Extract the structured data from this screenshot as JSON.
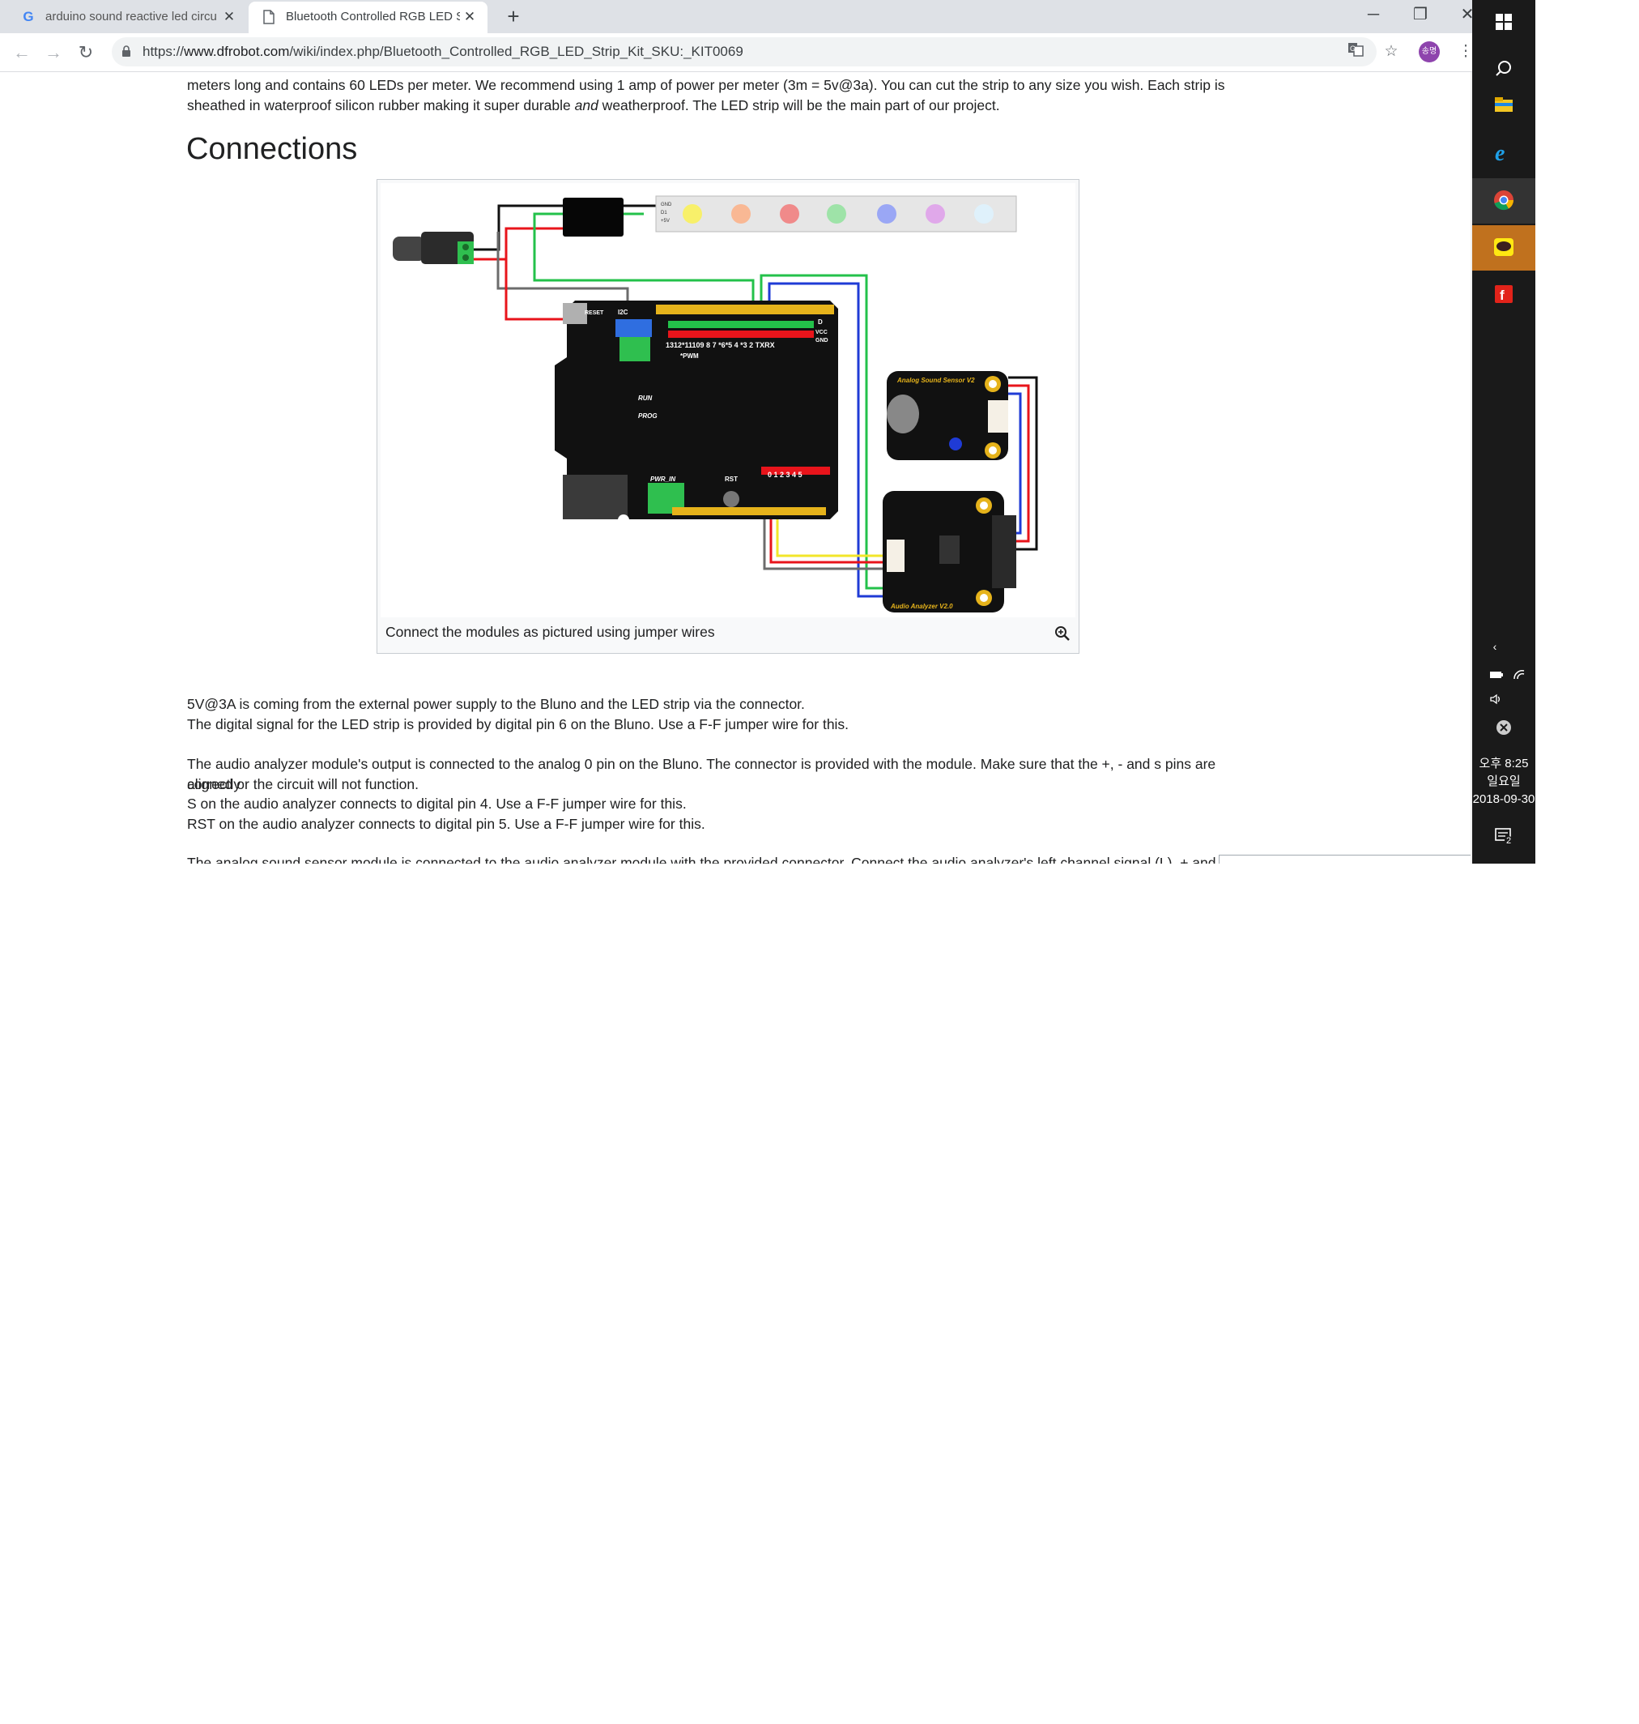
{
  "browser": {
    "tabs": [
      {
        "title": "arduino sound reactive led circu",
        "close": "✕",
        "favicon": "G"
      },
      {
        "title": "Bluetooth Controlled RGB LED S",
        "close": "✕",
        "favicon": "doc-icon"
      }
    ],
    "new_tab": "+",
    "window_controls": {
      "minimize": "─",
      "maximize": "❐",
      "close": "✕"
    },
    "nav": {
      "back": "←",
      "forward": "→",
      "reload": "↻"
    },
    "url": {
      "scheme": "https://",
      "host": "www.dfrobot.com",
      "path": "/wiki/index.php/Bluetooth_Controlled_RGB_LED_Strip_Kit_SKU:_KIT0069"
    },
    "toolbar_icons": {
      "translate": "translate-icon",
      "bookmark": "☆",
      "menu": "⋮"
    },
    "avatar_text": "송명"
  },
  "page": {
    "intro_lines": [
      "meters long and contains 60 LEDs per meter. We recommend using 1 amp of power per meter (3m = 5v@3a). You can cut the strip to any size you wish. Each strip is",
      "sheathed in waterproof silicon rubber making it super durable ",
      "and",
      " weatherproof. The LED strip will be the main part of our project."
    ],
    "heading": "Connections",
    "figure": {
      "caption": "Connect the modules as pictured using jumper wires",
      "labels": {
        "reset": "RESET",
        "i2c": "I2C",
        "d": "D",
        "vcc": "VCC",
        "gnd": "GND",
        "digital_pins": "1312*11109 8  7 *6*5 4  *3 2 TXRX",
        "pwm": "*PWM",
        "run": "RUN",
        "prog": "PROG",
        "pwr_in": "PWR_IN",
        "rst": "RST",
        "analog_pins": "0 1 2 3 4 5",
        "sound_sensor": "Analog Sound Sensor V2",
        "audio_analyzer": "Audio Analyzer V2.0",
        "strip_pins": [
          "GND",
          "D1",
          "+5V"
        ]
      }
    },
    "body_lines": [
      "5V@3A is coming from the external power supply to the Bluno and the LED strip via the connector.",
      "The digital signal for the LED strip is provided by digital pin 6 on the Bluno. Use a F-F jumper wire for this.",
      "The audio analyzer module's output is connected to the analog 0 pin on the Bluno. The connector is provided with the module. Make sure that the +, - and s pins are correctly",
      "aligned or the circuit will not function.",
      "S on the audio analyzer connects to digital pin 4. Use a F-F jumper wire for this.",
      "RST on the audio analyzer connects to digital pin 5. Use a F-F jumper wire for this.",
      "The analog sound sensor module is connected to the audio analyzer module with the provided connector. Connect the audio analyzer's left channel signal (L), + and - t"
    ]
  },
  "taskbar": {
    "clock_time": "오후 8:25",
    "clock_day": "일요일",
    "clock_date": "2018-09-30",
    "notification_count": "2",
    "kakao_label": "TALK"
  },
  "colors": {
    "tabstrip": "#dee1e6",
    "taskbar": "#1a1a1a",
    "wire_red": "#e8141b",
    "wire_green": "#23c14a",
    "wire_blue": "#1f3bd6",
    "wire_yellow": "#f2e62a",
    "wire_gray": "#6c6c6c"
  }
}
